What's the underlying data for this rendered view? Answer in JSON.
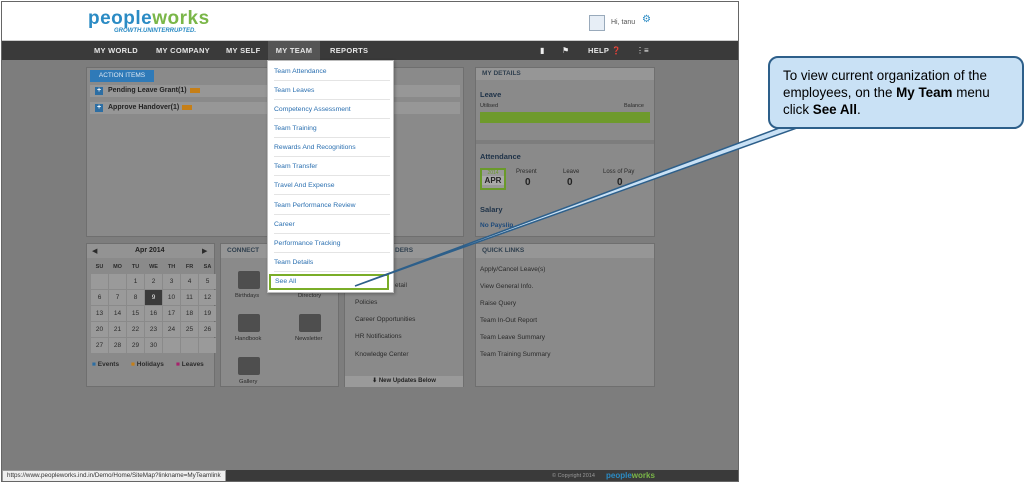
{
  "header": {
    "logo_people": "people",
    "logo_works": "works",
    "tagline": "GROWTH.UNINTERRUPTED.",
    "greeting": "Hi, tanu"
  },
  "nav": {
    "items": [
      "MY WORLD",
      "MY COMPANY",
      "MY SELF",
      "MY TEAM",
      "REPORTS"
    ],
    "help": "HELP"
  },
  "action_items": {
    "tab": "ACTION ITEMS",
    "rows": [
      "Pending Leave Grant(1)",
      "Approve Handover(1)"
    ]
  },
  "my_team_menu": {
    "items": [
      "Team Attendance",
      "Team Leaves",
      "Competency Assessment",
      "Team Training",
      "Rewards And Recognitions",
      "Team Transfer",
      "Travel And Expense",
      "Team Performance Review",
      "Career",
      "Performance Tracking",
      "Team Details"
    ],
    "see_all": "See All"
  },
  "my_details": {
    "title": "MY DETAILS",
    "leave": {
      "title": "Leave",
      "utilised": "Utilised",
      "balance": "Balance"
    },
    "attendance": {
      "title": "Attendance",
      "year": "2014",
      "month": "APR",
      "present_label": "Present",
      "present": "0",
      "leave_label": "Leave",
      "leave": "0",
      "lop_label": "Loss of Pay",
      "lop": "0"
    },
    "salary": {
      "title": "Salary",
      "payslip": "No Payslip"
    }
  },
  "calendar": {
    "month": "Apr 2014",
    "days": [
      "SU",
      "MO",
      "TU",
      "WE",
      "TH",
      "FR",
      "SA"
    ],
    "weeks": [
      [
        "",
        "",
        "1",
        "2",
        "3",
        "4",
        "5"
      ],
      [
        "6",
        "7",
        "8",
        "9",
        "10",
        "11",
        "12"
      ],
      [
        "13",
        "14",
        "15",
        "16",
        "17",
        "18",
        "19"
      ],
      [
        "20",
        "21",
        "22",
        "23",
        "24",
        "25",
        "26"
      ],
      [
        "27",
        "28",
        "29",
        "30",
        "",
        "",
        ""
      ]
    ],
    "legend": [
      "Events",
      "Holidays",
      "Leaves"
    ]
  },
  "connect": {
    "title": "CONNECT",
    "items": [
      "Birthdays",
      "Directory",
      "Handbook",
      "Newsletter",
      "Gallery"
    ]
  },
  "leaders": {
    "title": "DERS",
    "items": [
      "etail",
      "Policies",
      "Career Opportunities",
      "HR Notifications",
      "Knowledge Center"
    ],
    "footer": "New Updates Below"
  },
  "quick_links": {
    "title": "QUICK LINKS",
    "items": [
      "Apply/Cancel Leave(s)",
      "View General Info.",
      "Raise Query",
      "Team In-Out Report",
      "Team Leave Summary",
      "Team Training Summary"
    ]
  },
  "status": {
    "url": "https://www.peopleworks.ind.in/Demo/Home/SiteMap?linkname=MyTeamlink",
    "copyright": "© Copyright 2014"
  },
  "callout": {
    "text_1": "To view current organization of the employees, on the ",
    "bold_1": "My  Team",
    "text_2": " menu click ",
    "bold_2": "See All",
    "text_3": "."
  },
  "colors": {
    "brand_blue": "#2b8bc4",
    "brand_green": "#7ab648",
    "highlight": "#7aad28",
    "callout_bg": "#c9e1f5",
    "callout_border": "#2d5f8a"
  }
}
